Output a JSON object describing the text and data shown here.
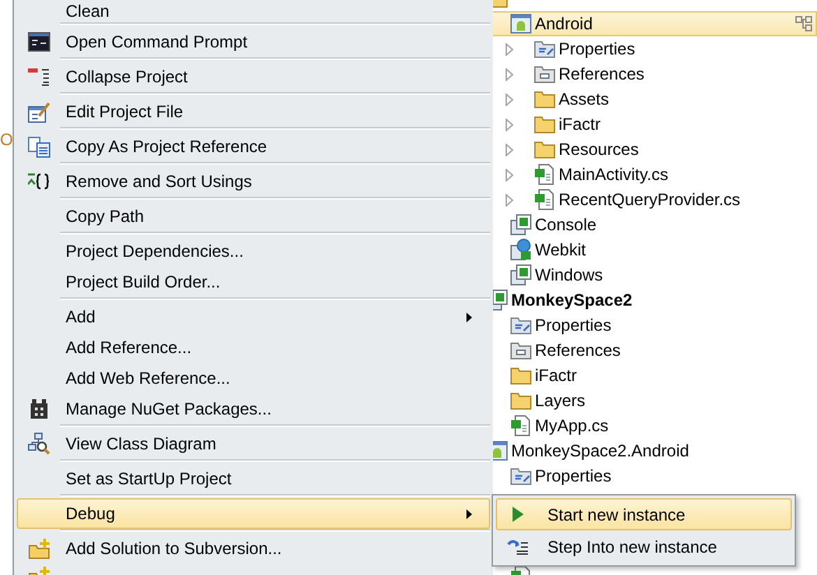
{
  "left_edge_text": "O",
  "tree": {
    "nodes": [
      {
        "kind": "folder",
        "selected": false,
        "startup": false,
        "children": [
          {
            "label": "Android",
            "kind": "android-project",
            "selected": true,
            "startup": false,
            "children": [
              {
                "label": "Properties",
                "kind": "properties",
                "selected": false,
                "expander": true
              },
              {
                "label": "References",
                "kind": "references",
                "selected": false,
                "expander": true
              },
              {
                "label": "Assets",
                "kind": "folder",
                "selected": false,
                "expander": true
              },
              {
                "label": "iFactr",
                "kind": "folder",
                "selected": false,
                "expander": true
              },
              {
                "label": "Resources",
                "kind": "folder",
                "selected": false,
                "expander": true
              },
              {
                "label": "MainActivity.cs",
                "kind": "cs-file",
                "selected": false,
                "expander": true
              },
              {
                "label": "RecentQueryProvider.cs",
                "kind": "cs-file",
                "selected": false,
                "expander": true
              }
            ]
          },
          {
            "label": "Console",
            "kind": "cs-project",
            "selected": false,
            "startup": false
          },
          {
            "label": "Webkit",
            "kind": "web-project",
            "selected": false,
            "startup": false
          },
          {
            "label": "Windows",
            "kind": "cs-project",
            "selected": false,
            "startup": false
          }
        ]
      },
      {
        "label": "MonkeySpace2",
        "kind": "cs-project",
        "selected": false,
        "startup": true,
        "children": [
          {
            "label": "Properties",
            "kind": "properties",
            "selected": false
          },
          {
            "label": "References",
            "kind": "references",
            "selected": false
          },
          {
            "label": "iFactr",
            "kind": "folder",
            "selected": false
          },
          {
            "label": "Layers",
            "kind": "folder",
            "selected": false
          },
          {
            "label": "MyApp.cs",
            "kind": "cs-file",
            "selected": false
          }
        ]
      },
      {
        "label": "MonkeySpace2.Android",
        "kind": "android-project",
        "selected": false,
        "startup": false,
        "children": [
          {
            "label": "Properties",
            "kind": "properties",
            "selected": false
          },
          {
            "kind": "cs-file",
            "selected": false
          }
        ]
      }
    ]
  },
  "menu": {
    "items": [
      {
        "kind": "item",
        "label": "Clean",
        "submenu": false,
        "selected": false
      },
      {
        "kind": "separator"
      },
      {
        "kind": "item",
        "label": "Open Command Prompt",
        "submenu": false,
        "selected": false
      },
      {
        "kind": "separator"
      },
      {
        "kind": "item",
        "label": "Collapse Project",
        "submenu": false,
        "selected": false
      },
      {
        "kind": "separator"
      },
      {
        "kind": "item",
        "label": "Edit Project File",
        "submenu": false,
        "selected": false
      },
      {
        "kind": "separator"
      },
      {
        "kind": "item",
        "label": "Copy As Project Reference",
        "submenu": false,
        "selected": false
      },
      {
        "kind": "separator"
      },
      {
        "kind": "item",
        "label": "Remove and Sort Usings",
        "submenu": false,
        "selected": false
      },
      {
        "kind": "separator"
      },
      {
        "kind": "item",
        "label": "Copy Path",
        "submenu": false,
        "selected": false
      },
      {
        "kind": "separator"
      },
      {
        "kind": "item",
        "label": "Project Dependencies...",
        "submenu": false,
        "selected": false
      },
      {
        "kind": "item",
        "label": "Project Build Order...",
        "submenu": false,
        "selected": false
      },
      {
        "kind": "separator"
      },
      {
        "kind": "item",
        "label": "Add",
        "submenu": true,
        "selected": false
      },
      {
        "kind": "item",
        "label": "Add Reference...",
        "submenu": false,
        "selected": false
      },
      {
        "kind": "item",
        "label": "Add Web Reference...",
        "submenu": false,
        "selected": false
      },
      {
        "kind": "item",
        "label": "Manage NuGet Packages...",
        "submenu": false,
        "selected": false
      },
      {
        "kind": "separator"
      },
      {
        "kind": "item",
        "label": "View Class Diagram",
        "submenu": false,
        "selected": false
      },
      {
        "kind": "separator"
      },
      {
        "kind": "item",
        "label": "Set as StartUp Project",
        "submenu": false,
        "selected": false
      },
      {
        "kind": "separator"
      },
      {
        "kind": "item",
        "label": "Debug",
        "submenu": true,
        "selected": true
      },
      {
        "kind": "separator"
      },
      {
        "kind": "item",
        "label": "Add Solution to Subversion...",
        "submenu": false,
        "selected": false
      },
      {
        "kind": "item",
        "selected": false
      }
    ]
  },
  "submenu": {
    "items": [
      {
        "label": "Start new instance",
        "selected": true
      },
      {
        "label": "Step Into new instance",
        "selected": false
      }
    ]
  }
}
